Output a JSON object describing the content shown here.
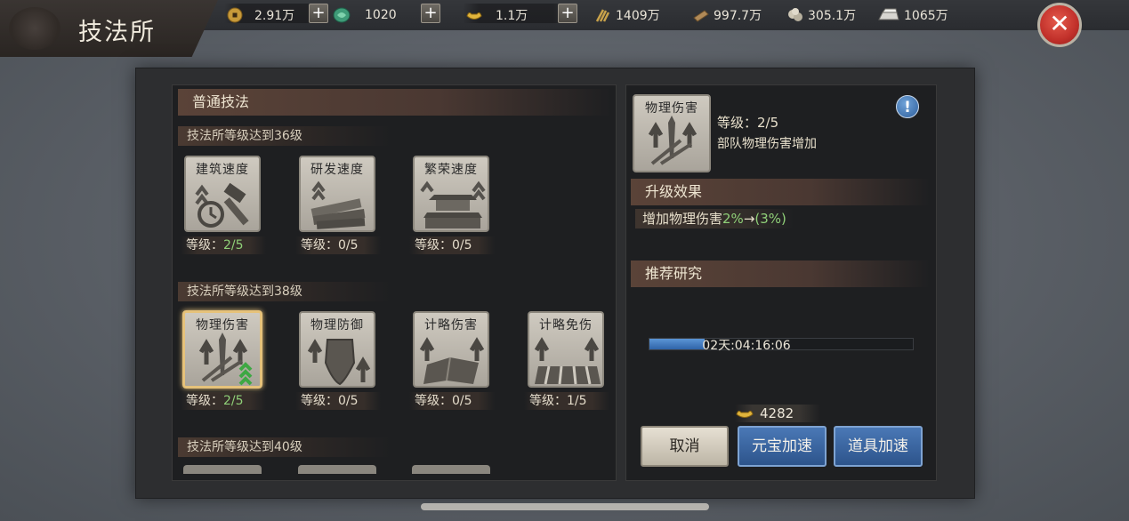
{
  "title": "技法所",
  "resources": {
    "copper": "2.91万",
    "jade": "1020",
    "gold": "1.1万",
    "grain": "1409万",
    "wood": "997.7万",
    "stone": "305.1万",
    "iron": "1065万"
  },
  "left": {
    "header": "普通技法",
    "sections": [
      {
        "requirement": "技法所等级达到36级",
        "skills": [
          {
            "name": "建筑速度",
            "level_label": "等级：",
            "level": "2/5"
          },
          {
            "name": "研发速度",
            "level_label": "等级：",
            "level": "0/5"
          },
          {
            "name": "繁荣速度",
            "level_label": "等级：",
            "level": "0/5"
          }
        ]
      },
      {
        "requirement": "技法所等级达到38级",
        "skills": [
          {
            "name": "物理伤害",
            "level_label": "等级：",
            "level": "2/5"
          },
          {
            "name": "物理防御",
            "level_label": "等级：",
            "level": "0/5"
          },
          {
            "name": "计略伤害",
            "level_label": "等级：",
            "level": "0/5"
          },
          {
            "name": "计略免伤",
            "level_label": "等级：",
            "level": "1/5"
          }
        ]
      },
      {
        "requirement": "技法所等级达到40级"
      }
    ]
  },
  "detail": {
    "name": "物理伤害",
    "level_label": "等级：",
    "level": "2/5",
    "description": "部队物理伤害增加",
    "info": "!",
    "effect_header": "升级效果",
    "effect_prefix": "增加物理伤害",
    "effect_current": "2%",
    "effect_arrow": "→",
    "effect_next": "(3%)",
    "recommend_header": "推荐研究",
    "timer": "02天:04:16:06",
    "progress": 0.21,
    "cost": "4282",
    "cancel": "取消",
    "gold_speedup": "元宝加速",
    "item_speedup": "道具加速"
  }
}
